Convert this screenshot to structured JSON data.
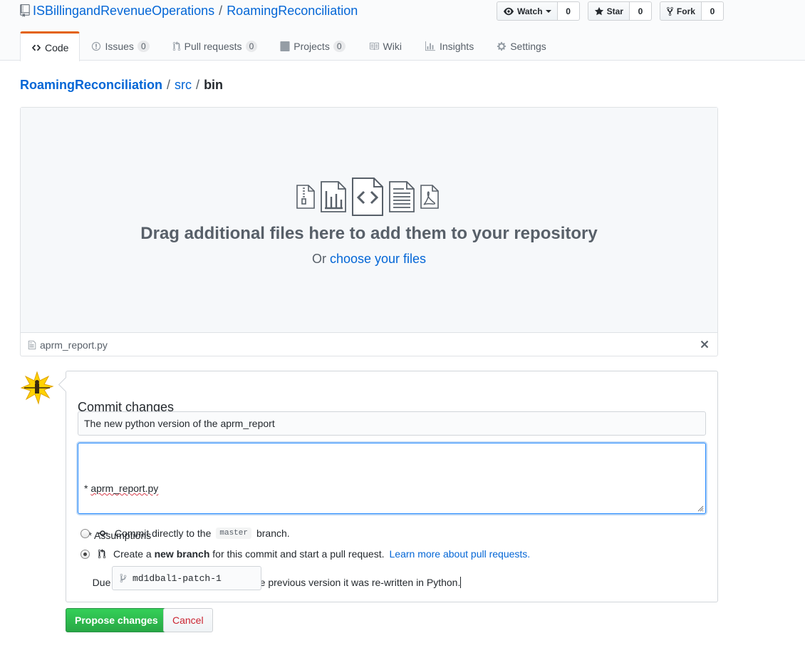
{
  "header": {
    "owner": "ISBillingandRevenueOperations",
    "separator": "/",
    "repo": "RoamingReconciliation",
    "actions": [
      {
        "label": "Watch",
        "count": "0",
        "icon": "eye-icon"
      },
      {
        "label": "Star",
        "count": "0",
        "icon": "star-icon"
      },
      {
        "label": "Fork",
        "count": "0",
        "icon": "fork-icon"
      }
    ]
  },
  "nav": {
    "tabs": [
      {
        "label": "Code",
        "icon": "code-icon",
        "selected": true
      },
      {
        "label": "Issues",
        "counter": "0",
        "icon": "issue-icon"
      },
      {
        "label": "Pull requests",
        "counter": "0",
        "icon": "pull-request-icon"
      },
      {
        "label": "Projects",
        "counter": "0",
        "icon": "project-icon"
      },
      {
        "label": "Wiki",
        "icon": "book-icon"
      },
      {
        "label": "Insights",
        "icon": "graph-icon"
      },
      {
        "label": "Settings",
        "icon": "gear-icon"
      }
    ]
  },
  "breadcrumb": {
    "root": "RoamingReconciliation",
    "path": "src",
    "current": "bin",
    "separator": "/"
  },
  "dropzone": {
    "title": "Drag additional files here to add them to your repository",
    "prefix": "Or",
    "link": "choose your files",
    "file_name": "aprm_report.py"
  },
  "commit": {
    "title": "Commit changes",
    "summary": "The new python version of the aprm_report",
    "description_lines": [
      "* aprm_report.py",
      "** Assumptions",
      "   Due to slow system performance of the previous version it was re-written in Python."
    ],
    "option_direct": {
      "before": "Commit directly to the",
      "branch": "master",
      "after": "branch."
    },
    "option_new": {
      "prefix": "Create a",
      "bold": "new branch",
      "suffix": "for this commit and start a pull request.",
      "link": "Learn more about pull requests."
    },
    "selected_option": "new-branch",
    "branch_name": "md1dbal1-patch-1",
    "propose_label": "Propose changes",
    "cancel_label": "Cancel"
  },
  "colors": {
    "link": "#0366d6",
    "tab_accent": "#e36209",
    "primary_button": "#28a745",
    "cancel_text": "#cb2431"
  }
}
